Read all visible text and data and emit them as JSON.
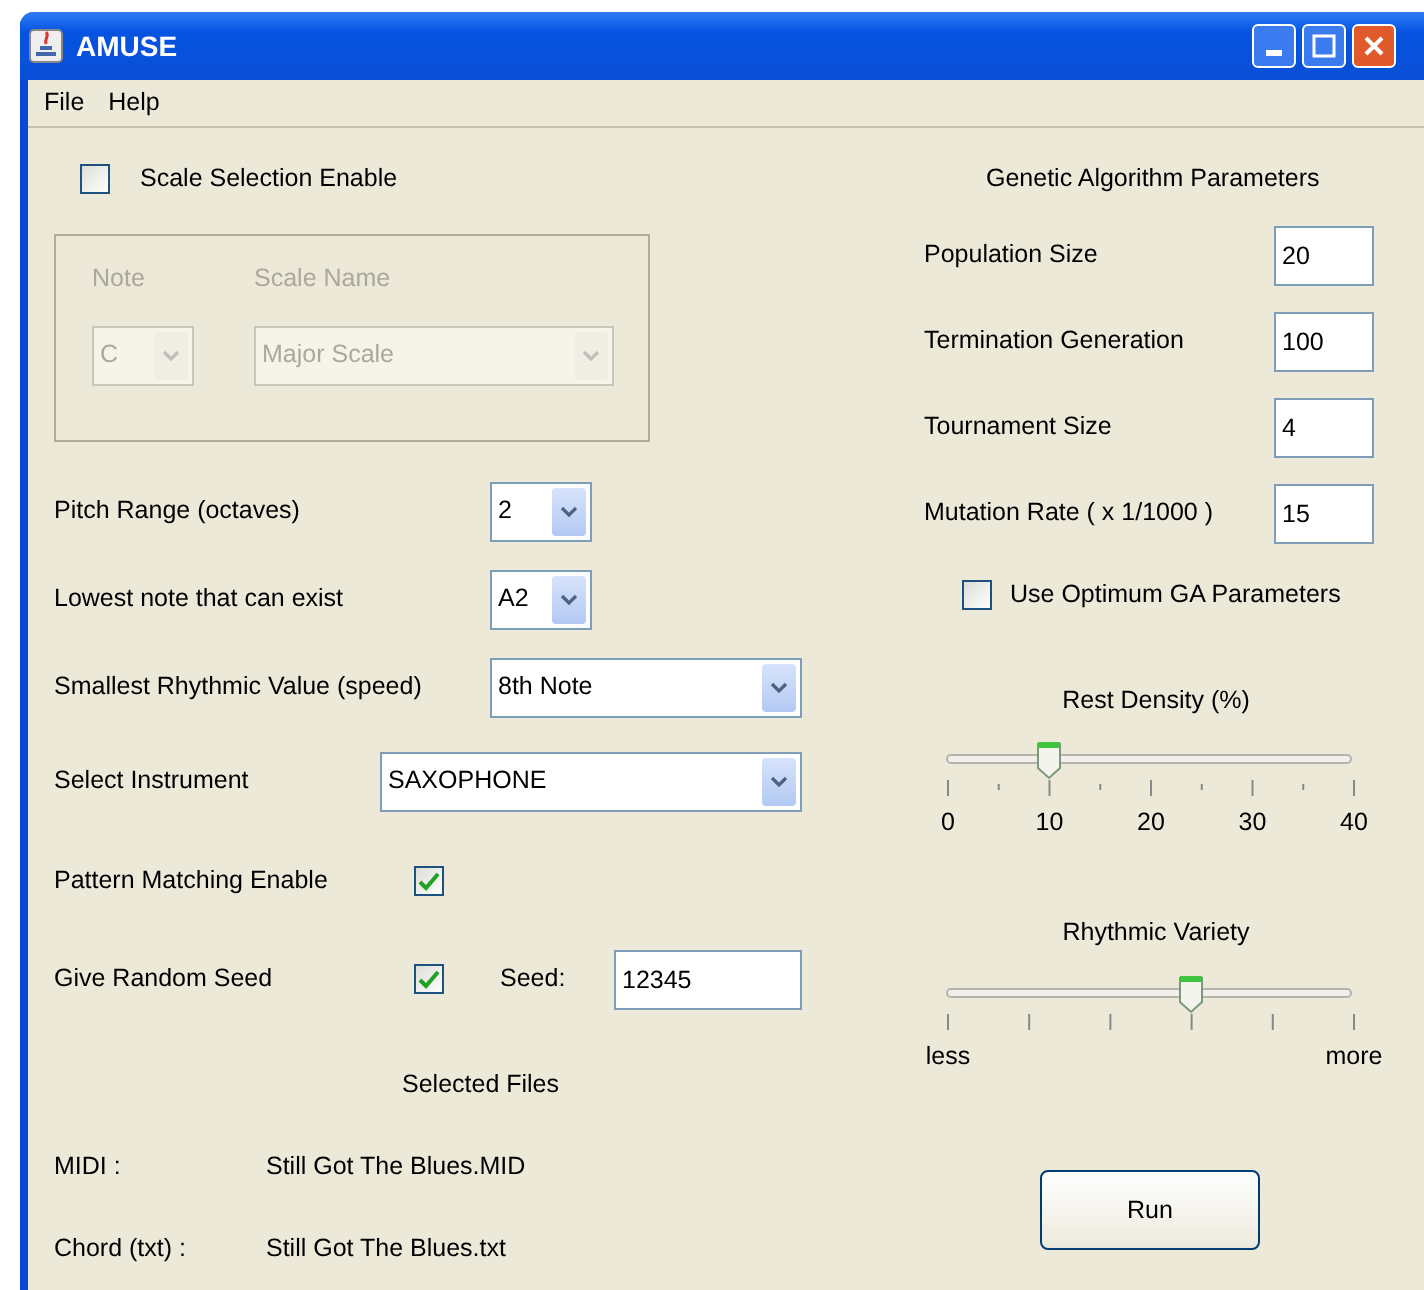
{
  "window": {
    "title": "AMUSE"
  },
  "menu": [
    "File",
    "Help"
  ],
  "scale_selection": {
    "label": "Scale Selection Enable",
    "checked": false,
    "note": {
      "label": "Note",
      "value": "C",
      "disabled": true
    },
    "scale_name": {
      "label": "Scale Name",
      "value": "Major Scale",
      "disabled": true
    }
  },
  "settings": [
    {
      "kind": "combo",
      "label": "Pitch Range (octaves)",
      "value": "2"
    },
    {
      "kind": "combo",
      "label": "Lowest note that can exist",
      "value": "A2"
    },
    {
      "kind": "combo",
      "label": "Smallest Rhythmic Value (speed)",
      "value": "8th Note"
    },
    {
      "kind": "combo",
      "label": "Select Instrument",
      "value": "SAXOPHONE"
    },
    {
      "kind": "check",
      "label": "Pattern Matching Enable",
      "checked": true
    },
    {
      "kind": "seed",
      "label": "Give Random Seed",
      "checked": true,
      "seed_label": "Seed:",
      "seed_value": "12345"
    }
  ],
  "selected_files": {
    "title": "Selected Files",
    "files": [
      {
        "label": "MIDI :",
        "value": "Still Got The Blues.MID"
      },
      {
        "label": "Chord (txt) :",
        "value": "Still Got The Blues.txt"
      }
    ]
  },
  "ga_parameters": {
    "title": "Genetic Algorithm Parameters",
    "fields": [
      {
        "label": "Population Size",
        "value": "20"
      },
      {
        "label": "Termination Generation",
        "value": "100"
      },
      {
        "label": "Tournament Size",
        "value": "4"
      },
      {
        "label": "Mutation Rate ( x 1/1000 )",
        "value": "15"
      }
    ],
    "optimum": {
      "label": "Use Optimum GA Parameters",
      "checked": false
    }
  },
  "sliders": [
    {
      "kind": "numeric",
      "label": "Rest Density (%)",
      "level": 0.25,
      "tick_labels": [
        "0",
        "10",
        "20",
        "30",
        "40"
      ]
    },
    {
      "kind": "range",
      "label": "Rhythmic Variety",
      "level": 0.6,
      "tick_labels": [
        "less",
        "more"
      ]
    }
  ],
  "run_button": "Run"
}
